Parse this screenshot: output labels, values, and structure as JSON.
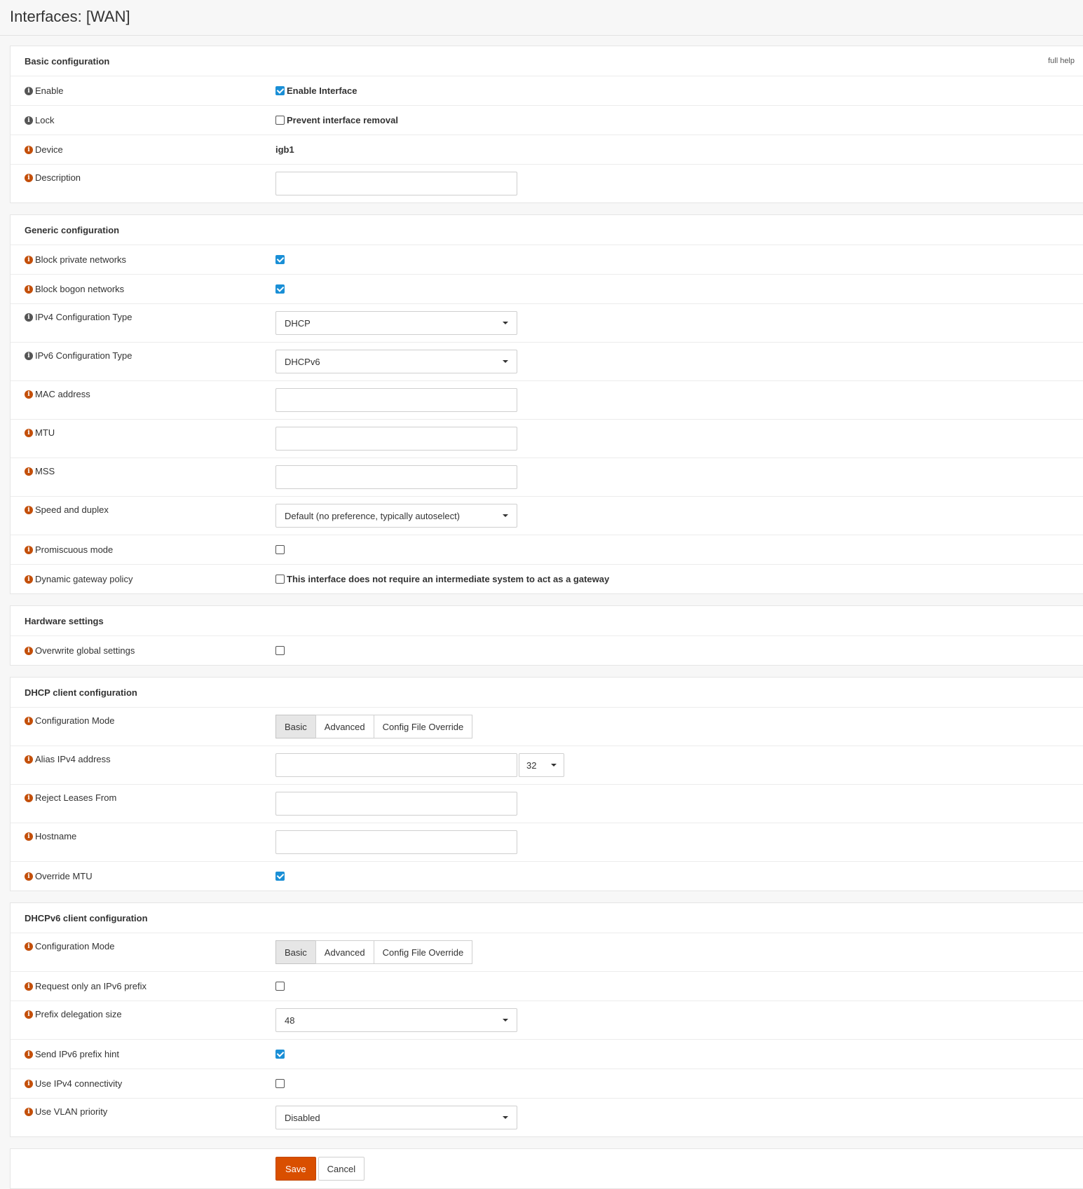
{
  "page_title": "Interfaces: [WAN]",
  "full_help": "full help",
  "basic": {
    "title": "Basic configuration",
    "enable_label": "Enable",
    "enable_cb_text": "Enable Interface",
    "lock_label": "Lock",
    "lock_cb_text": "Prevent interface removal",
    "device_label": "Device",
    "device_value": "igb1",
    "description_label": "Description",
    "description_value": ""
  },
  "generic": {
    "title": "Generic configuration",
    "block_private_label": "Block private networks",
    "block_bogon_label": "Block bogon networks",
    "ipv4_type_label": "IPv4 Configuration Type",
    "ipv4_type_value": "DHCP",
    "ipv6_type_label": "IPv6 Configuration Type",
    "ipv6_type_value": "DHCPv6",
    "mac_label": "MAC address",
    "mtu_label": "MTU",
    "mss_label": "MSS",
    "speed_label": "Speed and duplex",
    "speed_value": "Default (no preference, typically autoselect)",
    "promiscuous_label": "Promiscuous mode",
    "dyn_gw_label": "Dynamic gateway policy",
    "dyn_gw_cb_text": "This interface does not require an intermediate system to act as a gateway"
  },
  "hardware": {
    "title": "Hardware settings",
    "overwrite_label": "Overwrite global settings"
  },
  "dhcp": {
    "title": "DHCP client configuration",
    "mode_label": "Configuration Mode",
    "mode_options": [
      "Basic",
      "Advanced",
      "Config File Override"
    ],
    "alias_label": "Alias IPv4 address",
    "alias_mask": "32",
    "reject_label": "Reject Leases From",
    "hostname_label": "Hostname",
    "override_mtu_label": "Override MTU"
  },
  "dhcp6": {
    "title": "DHCPv6 client configuration",
    "mode_label": "Configuration Mode",
    "mode_options": [
      "Basic",
      "Advanced",
      "Config File Override"
    ],
    "prefix_only_label": "Request only an IPv6 prefix",
    "prefix_size_label": "Prefix delegation size",
    "prefix_size_value": "48",
    "prefix_hint_label": "Send IPv6 prefix hint",
    "ipv4_conn_label": "Use IPv4 connectivity",
    "vlan_label": "Use VLAN priority",
    "vlan_value": "Disabled"
  },
  "actions": {
    "save": "Save",
    "cancel": "Cancel"
  },
  "colors": {
    "accent": "#d94f00",
    "info_orange": "#c34f0a",
    "checkbox_blue": "#1a8fd6"
  }
}
